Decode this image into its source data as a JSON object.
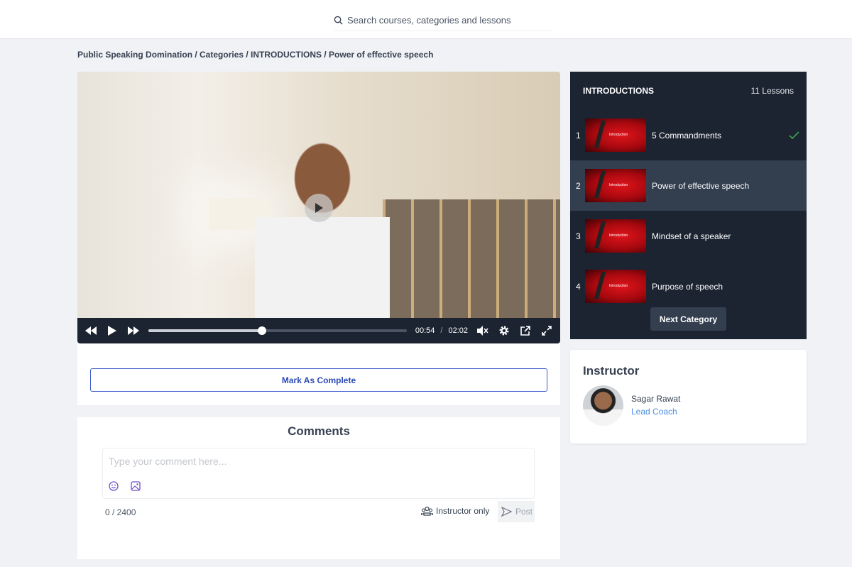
{
  "header": {
    "search_placeholder": "Search courses, categories and lessons"
  },
  "breadcrumb": "Public Speaking Domination / Categories / INTRODUCTIONS / Power of effective speech",
  "player": {
    "current_time": "00:54",
    "separator": "/",
    "duration": "02:02",
    "progress_percent": 44,
    "muted": true
  },
  "mark_complete_label": "Mark As Complete",
  "comments": {
    "title": "Comments",
    "placeholder": "Type your comment here...",
    "count": "0 / 2400",
    "visibility": "Instructor only",
    "post_label": "Post"
  },
  "lessons": {
    "category": "INTRODUCTIONS",
    "count": "11 Lessons",
    "thumb_text": "Introduction",
    "items": [
      {
        "num": "1",
        "title": "5 Commandments",
        "completed": true
      },
      {
        "num": "2",
        "title": "Power of effective speech",
        "active": true
      },
      {
        "num": "3",
        "title": "Mindset of a speaker"
      },
      {
        "num": "4",
        "title": "Purpose of speech"
      }
    ],
    "next_label": "Next Category"
  },
  "instructor": {
    "title": "Instructor",
    "name": "Sagar Rawat",
    "role": "Lead Coach"
  },
  "colors": {
    "panel": "#1c2432",
    "active_row": "#333e4f",
    "accent": "#3b5bcc",
    "check": "#3fa34d"
  }
}
